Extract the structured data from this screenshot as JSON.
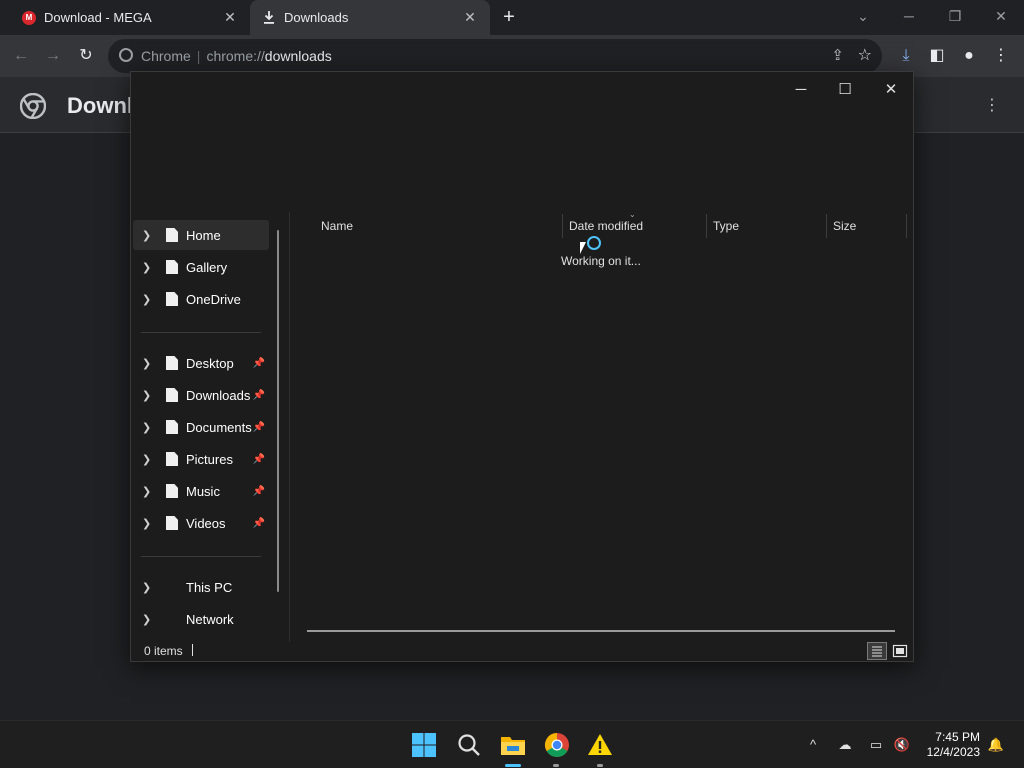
{
  "browser": {
    "tabs": [
      {
        "title": "Download - MEGA",
        "favicon": "mega-icon",
        "favicon_text": "M"
      },
      {
        "title": "Downloads",
        "favicon": "download-icon"
      }
    ],
    "omnibox": {
      "site_chip": "Chrome",
      "url_scheme": "chrome://",
      "url_path": "downloads"
    },
    "page_title": "Downl"
  },
  "dialog": {
    "nav": {
      "quick": [
        "Home",
        "Gallery",
        "OneDrive"
      ],
      "pinned": [
        "Desktop",
        "Downloads",
        "Documents",
        "Pictures",
        "Music",
        "Videos"
      ],
      "locations": [
        "This PC",
        "Network"
      ]
    },
    "columns": [
      "Name",
      "Date modified",
      "Type",
      "Size"
    ],
    "status_message": "Working on it...",
    "items_count": "0 items"
  },
  "taskbar": {
    "time": "7:45 PM",
    "date": "12/4/2023"
  },
  "colors": {
    "chrome_bg": "#202124",
    "toolbar_bg": "#35363a",
    "dialog_bg": "#1c1c1c",
    "spinner_accent": "#4fc3f7",
    "mega_red": "#d9272e"
  }
}
